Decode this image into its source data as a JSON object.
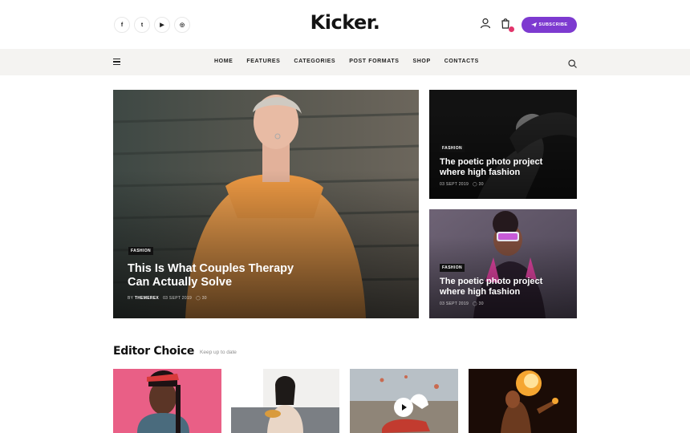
{
  "header": {
    "logo": "Kicker.",
    "socials": [
      {
        "icon": "facebook-icon",
        "glyph": "f"
      },
      {
        "icon": "twitter-icon",
        "glyph": "t"
      },
      {
        "icon": "youtube-icon",
        "glyph": "▶"
      },
      {
        "icon": "instagram-icon",
        "glyph": "◎"
      }
    ],
    "subscribe_label": "SUBSCRIBE",
    "accent_color": "#7d3ad0",
    "cart_badge_color": "#e2356b"
  },
  "nav": {
    "items": [
      "HOME",
      "FEATURES",
      "CATEGORIES",
      "POST FORMATS",
      "SHOP",
      "CONTACTS"
    ]
  },
  "hero": {
    "main": {
      "tag": "FASHION",
      "title_line1": "This Is What Couples Therapy",
      "title_line2": "Can Actually Solve",
      "author_prefix": "BY",
      "author": "THEMEREX",
      "date": "03 SEPT 2019",
      "comments": "30"
    },
    "side": [
      {
        "tag": "FASHION",
        "title_line1": "The poetic photo project",
        "title_line2": "where high fashion",
        "date": "03 SEPT 2019",
        "comments": "30"
      },
      {
        "tag": "FASHION",
        "title_line1": "The poetic photo project",
        "title_line2": "where high fashion",
        "date": "03 SEPT 2019",
        "comments": "30"
      }
    ]
  },
  "editor_choice": {
    "title": "Editor Choice",
    "subtitle": "Keep up to date"
  }
}
